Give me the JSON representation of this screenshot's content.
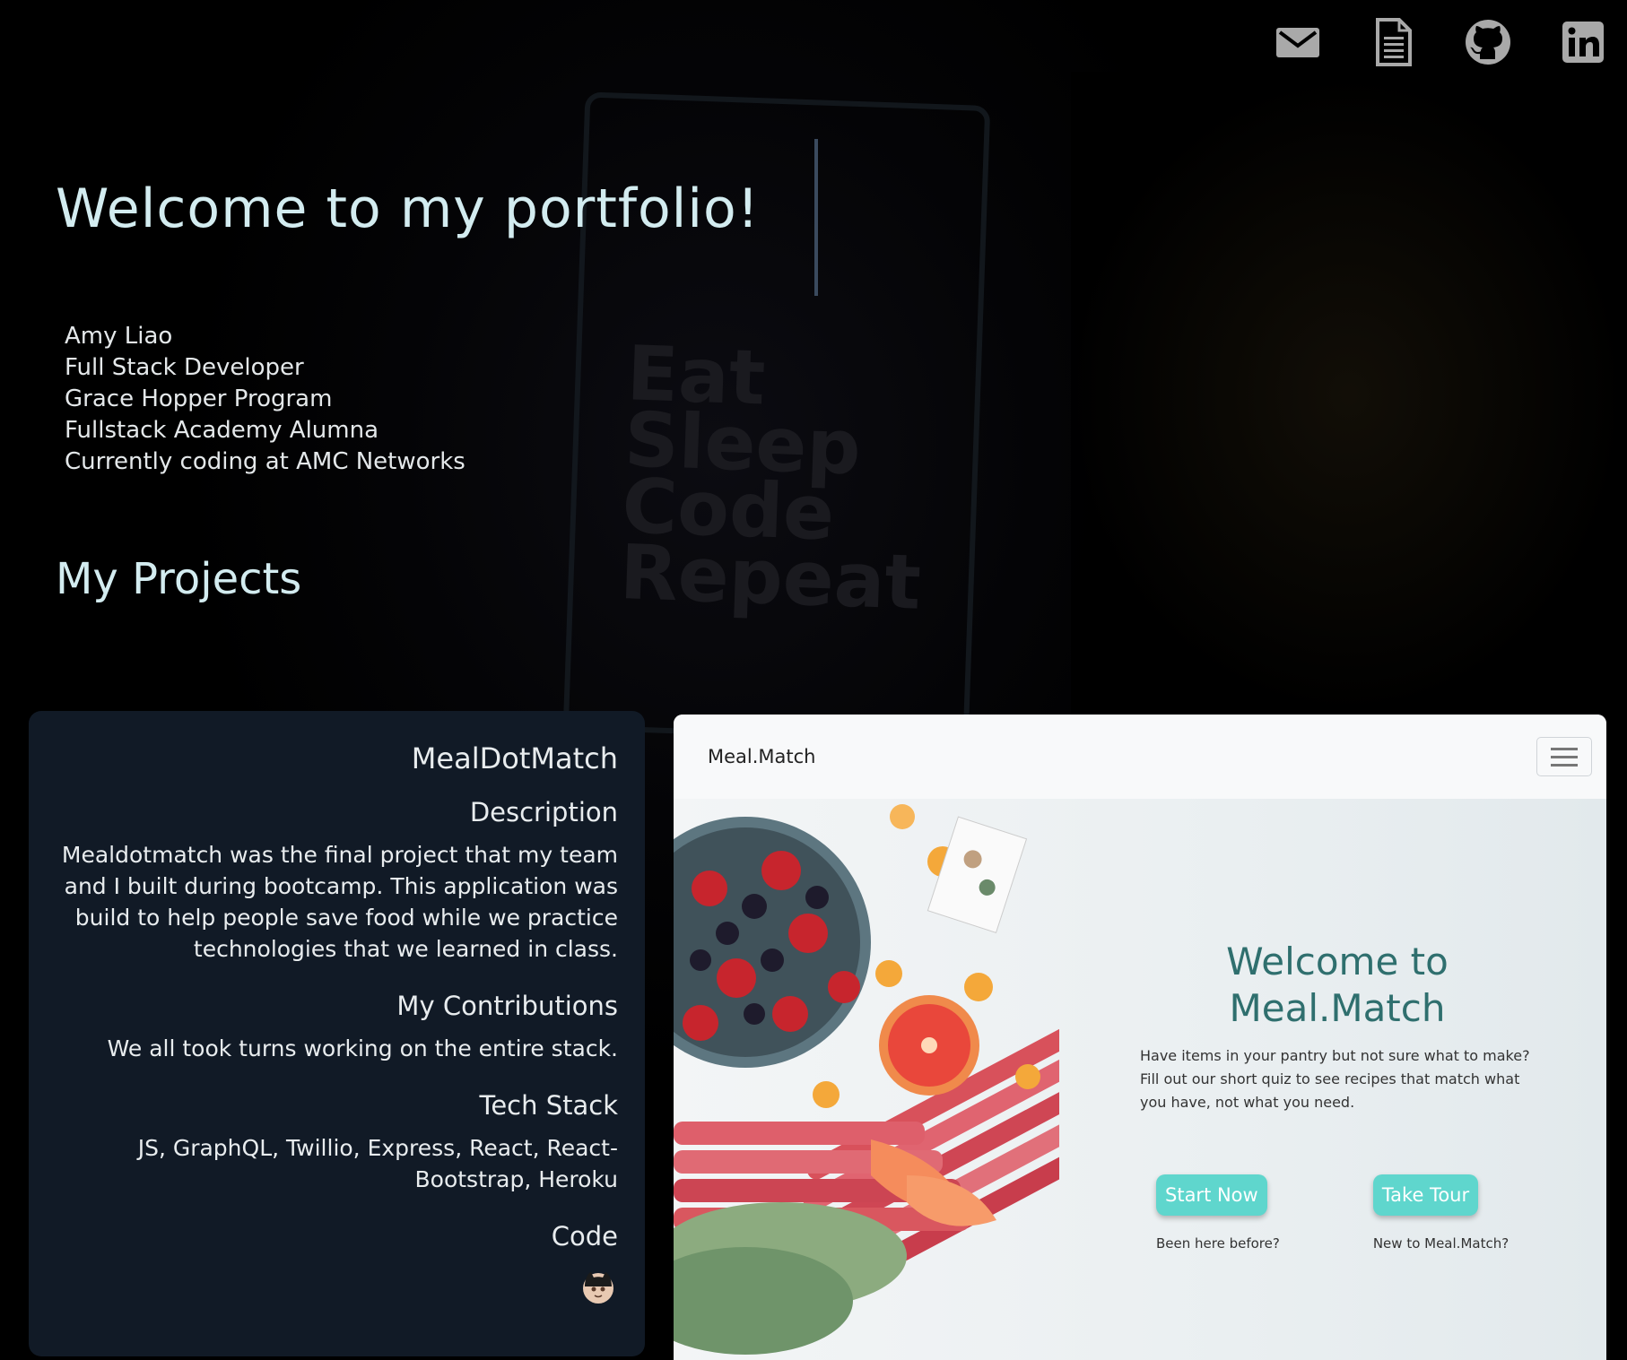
{
  "nav": {
    "icons": [
      "mail-icon",
      "resume-document-icon",
      "github-icon",
      "linkedin-icon"
    ],
    "color": "#a9a9a9"
  },
  "hero": {
    "headline": "Welcome to my portfolio!",
    "bio": [
      "Amy Liao",
      "Full Stack Developer",
      "Grace Hopper Program",
      "Fullstack Academy Alumna",
      "Currently coding at AMC Networks"
    ],
    "background_text": [
      "Eat",
      "Sleep",
      "Code",
      "Repeat"
    ]
  },
  "projects": {
    "title": "My Projects",
    "items": [
      {
        "name": "MealDotMatch",
        "description_heading": "Description",
        "description": "Mealdotmatch was the final project that my team and I built during bootcamp. This application was build to help people save food while we practice technologies that we learned in class.",
        "contributions_heading": "My Contributions",
        "contributions": "We all took turns working on the entire stack.",
        "tech_heading": "Tech Stack",
        "tech": "JS, GraphQL, Twillio, Express, React, React-Bootstrap, Heroku",
        "code_heading": "Code",
        "code_icon": "github-octocat-icon"
      }
    ]
  },
  "preview": {
    "brand": "Meal.Match",
    "menu_icon": "hamburger-menu-icon",
    "heading": "Welcome to Meal.Match",
    "text": "Have items in your pantry but not sure what to make? Fill out our short quiz to see recipes that match what you have, not what you need.",
    "start_label": "Start Now",
    "start_hint": "Been here before?",
    "tour_label": "Take Tour",
    "tour_hint": "New to Meal.Match?",
    "accent": "#5fd6cd",
    "heading_color": "#2f6f6e"
  },
  "colors": {
    "page_bg": "#000000",
    "card_bg": "#111a26",
    "headline": "#d3ecf0"
  }
}
